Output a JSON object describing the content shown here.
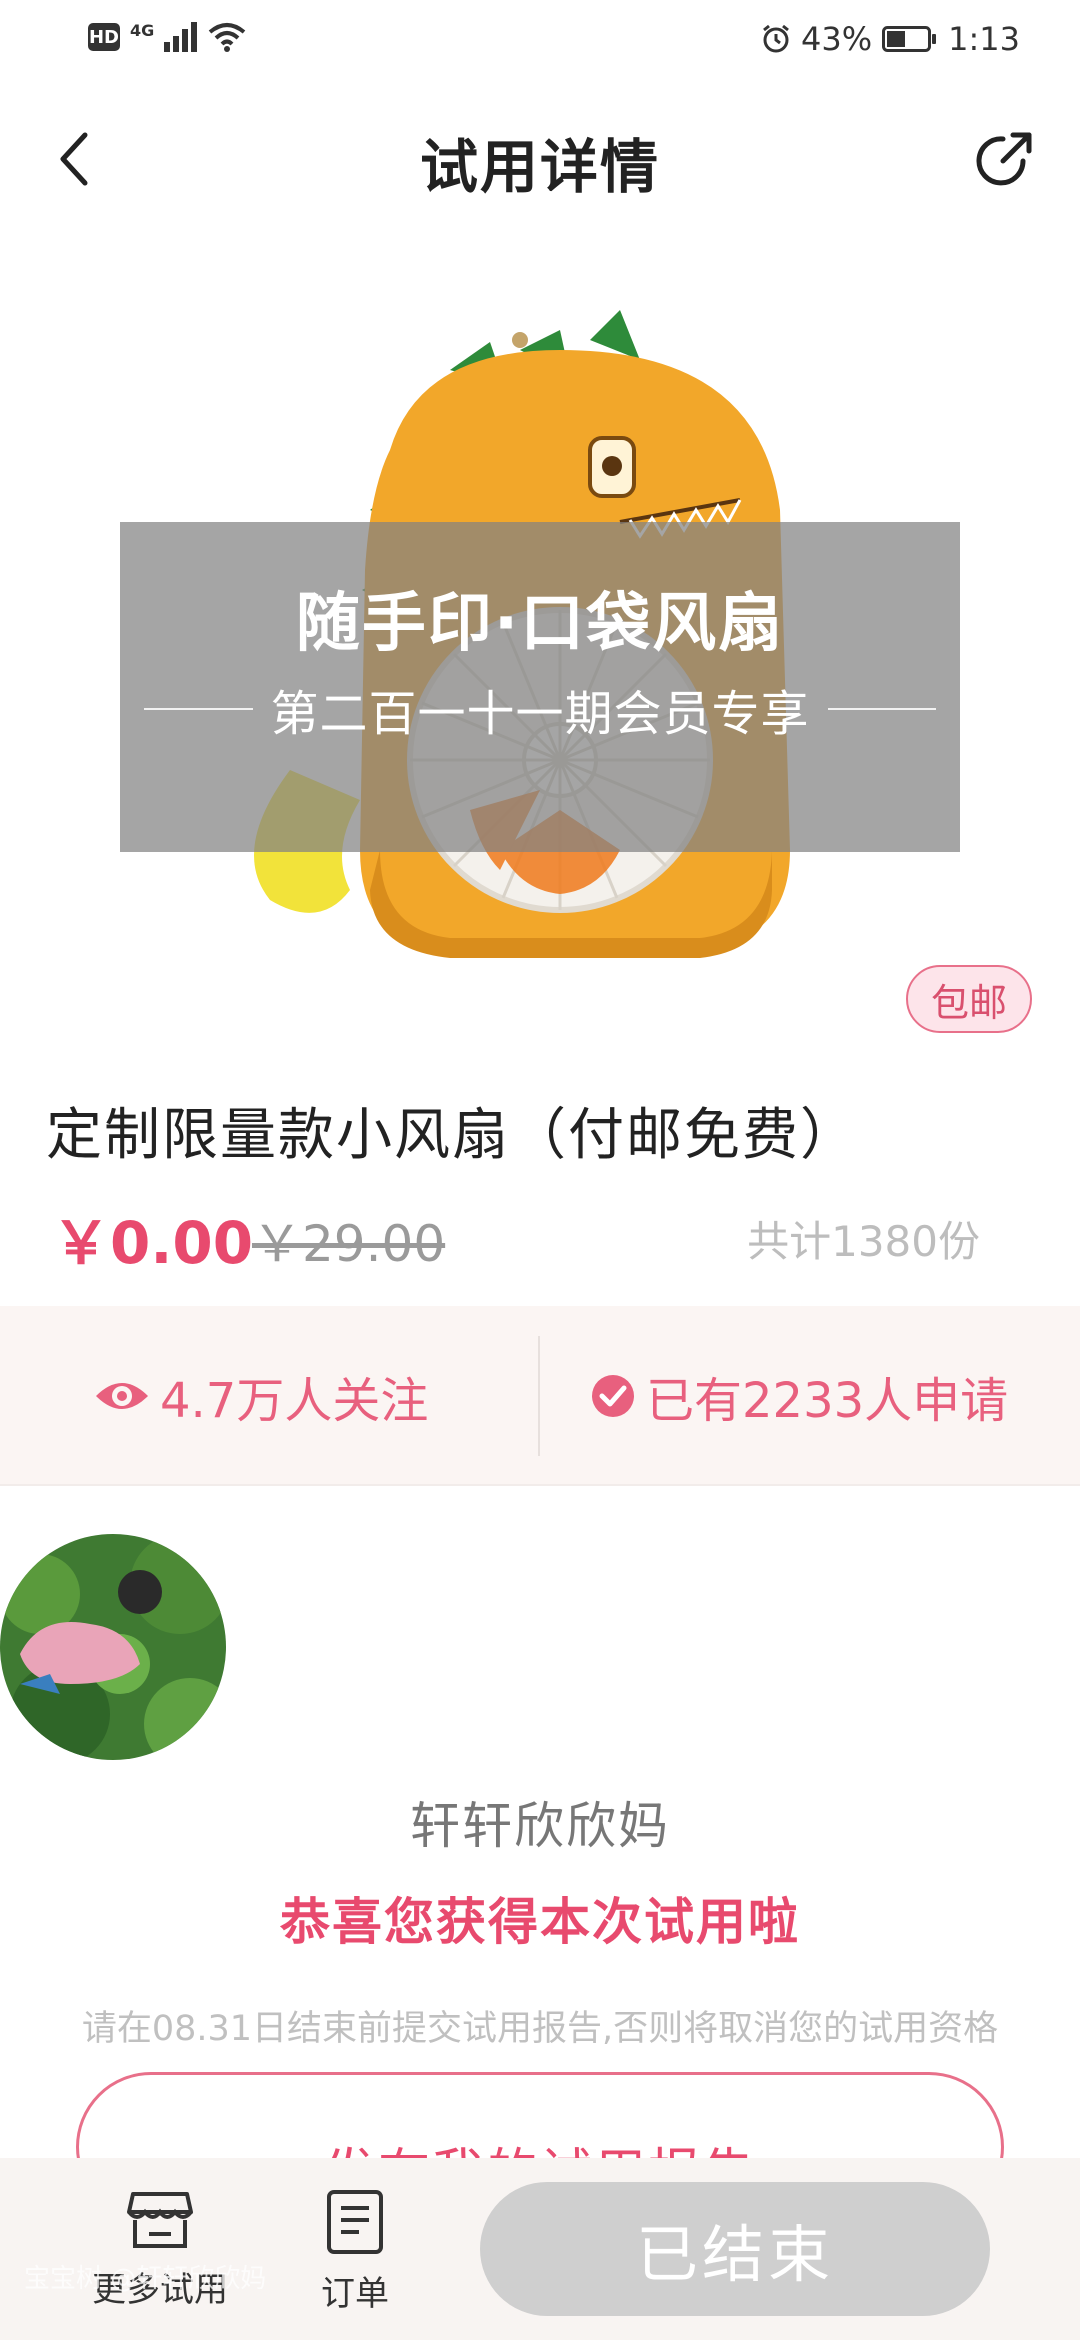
{
  "status_bar": {
    "network_label": "HD",
    "signal_type": "4G",
    "battery_percent": "43%",
    "time": "1:13"
  },
  "header": {
    "title": "试用详情"
  },
  "hero": {
    "overlay_title": "随手印·口袋风扇",
    "overlay_subtitle": "第二百一十一期会员专享",
    "shipping_badge": "包邮"
  },
  "product": {
    "name": "定制限量款小风扇（付邮免费）",
    "price_now": "￥0.00",
    "price_original": "￥29.00",
    "total_copies": "共计1380份"
  },
  "stats": {
    "followers": "4.7万人关注",
    "applicants": "已有2233人申请"
  },
  "winner": {
    "name": "轩轩欣欣妈",
    "congrats": "恭喜您获得本次试用啦",
    "notice": "请在08.31日结束前提交试用报告,否则将取消您的试用资格",
    "report_button": "发布我的试用报告"
  },
  "bottom_bar": {
    "tab_more": "更多试用",
    "tab_orders": "订单",
    "ended_button": "已结束",
    "watermark": "宝宝树 @轩轩欣欣妈"
  },
  "colors": {
    "accent": "#e84a6e",
    "muted": "#bdbdbd",
    "band": "#fbf5f3"
  }
}
